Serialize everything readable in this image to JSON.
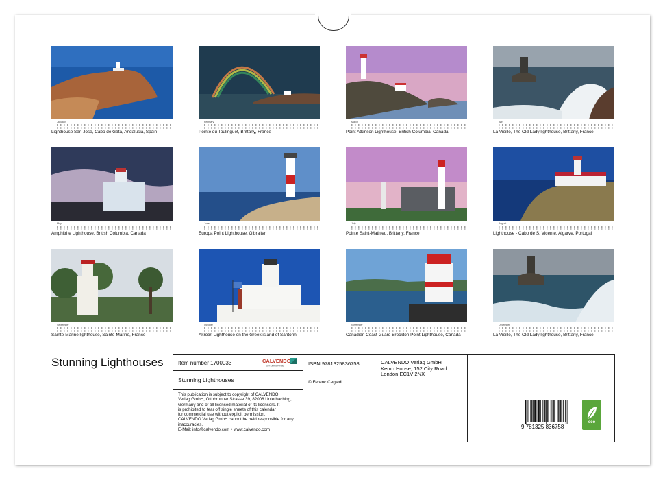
{
  "calendar": {
    "title": "Stunning Lighthouses",
    "months": [
      {
        "month": "January",
        "caption": "Lighthouse San Jose, Cabo de Gata, Andalusia, Spain"
      },
      {
        "month": "February",
        "caption": "Pointe du Toulinguet, Brittany, France"
      },
      {
        "month": "March",
        "caption": "Point Atkinson Lighthouse, British Columbia, Canada"
      },
      {
        "month": "April",
        "caption": "La Vieille, The Old Lady lighthouse, Brittany, France"
      },
      {
        "month": "May",
        "caption": "Amphitrite Lighthouse, British Columbia, Canada"
      },
      {
        "month": "June",
        "caption": "Europa Point Lighthouse, Gibraltar"
      },
      {
        "month": "July",
        "caption": "Pointe Saint-Mathieu, Brittany, France"
      },
      {
        "month": "August",
        "caption": "Lighthouse - Cabo de S. Vicente, Algarve, Portugal"
      },
      {
        "month": "September",
        "caption": "Sainte-Marine lighthouse, Sainte-Marine, France"
      },
      {
        "month": "October",
        "caption": "Akrotiri Lighthouse on the Greek island of Santorini"
      },
      {
        "month": "November",
        "caption": "Canadian Coast Guard Brockton Point Lighthouse, Canada"
      },
      {
        "month": "December",
        "caption": "La Vieille, The Old Lady lighthouse, Brittany, France"
      }
    ]
  },
  "info": {
    "item_number": "Item number 1700033",
    "logo_text": "CALVENDO",
    "logo_sub": "Der Kalenderverlag",
    "product_title": "Stunning Lighthouses",
    "copyright_lines": [
      "This publication is subject to copyright of CALVENDO",
      "Verlag GmbH, Ottobrunner Strasse 39, 82008 Unterhaching,",
      "Germany and of all licensed material of its licensors. It",
      "is prohibited to tear off single sheets of this calendar",
      "for commercial use without explicit permission.",
      "CALVENDO Verlag GmbH cannot be held responsible for any",
      "inaccuracies.",
      "E-Mail: info@calvendo.com • www.calvendo.com"
    ],
    "isbn": "ISBN 9781325836758",
    "author": "© Ferenc Cegledi",
    "publisher_lines": [
      "CALVENDO Verlag GmbH",
      "Kemp House, 152 City Road",
      "London EC1V 2NX"
    ],
    "barcode_digits": "9 781325 836758",
    "eco_label": "eco"
  }
}
